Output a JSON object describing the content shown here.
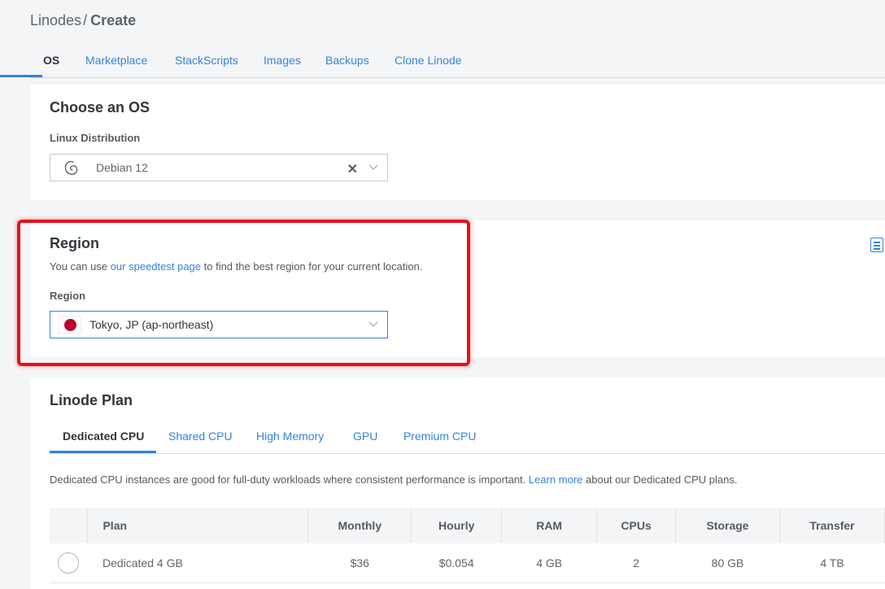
{
  "breadcrumb": {
    "parent": "Linodes",
    "separator": "/",
    "current": "Create"
  },
  "tabs": [
    "OS",
    "Marketplace",
    "StackScripts",
    "Images",
    "Backups",
    "Clone Linode"
  ],
  "os_section": {
    "title": "Choose an OS",
    "label": "Linux Distribution",
    "selected": "Debian 12",
    "icon": "debian-logo-icon",
    "clear_symbol": "✕"
  },
  "region_section": {
    "title": "Region",
    "help_prefix": "You can use ",
    "help_link": "our speedtest page",
    "help_suffix": " to find the best region for your current location.",
    "label": "Region",
    "selected": "Tokyo, JP (ap-northeast)",
    "flag": "japan-flag-icon"
  },
  "plan_section": {
    "title": "Linode Plan",
    "tabs": [
      "Dedicated CPU",
      "Shared CPU",
      "High Memory",
      "GPU",
      "Premium CPU"
    ],
    "description_prefix": "Dedicated CPU instances are good for full-duty workloads where consistent performance is important. ",
    "description_link": "Learn more",
    "description_suffix": " about our Dedicated CPU plans.",
    "columns": [
      "Plan",
      "Monthly",
      "Hourly",
      "RAM",
      "CPUs",
      "Storage",
      "Transfer"
    ],
    "rows": [
      {
        "plan": "Dedicated 4 GB",
        "monthly": "$36",
        "hourly": "$0.054",
        "ram": "4 GB",
        "cpus": "2",
        "storage": "80 GB",
        "transfer": "4 TB"
      }
    ]
  },
  "colors": {
    "accent": "#3683dc",
    "highlight": "#e0141b",
    "japan_red": "#bc002d"
  }
}
